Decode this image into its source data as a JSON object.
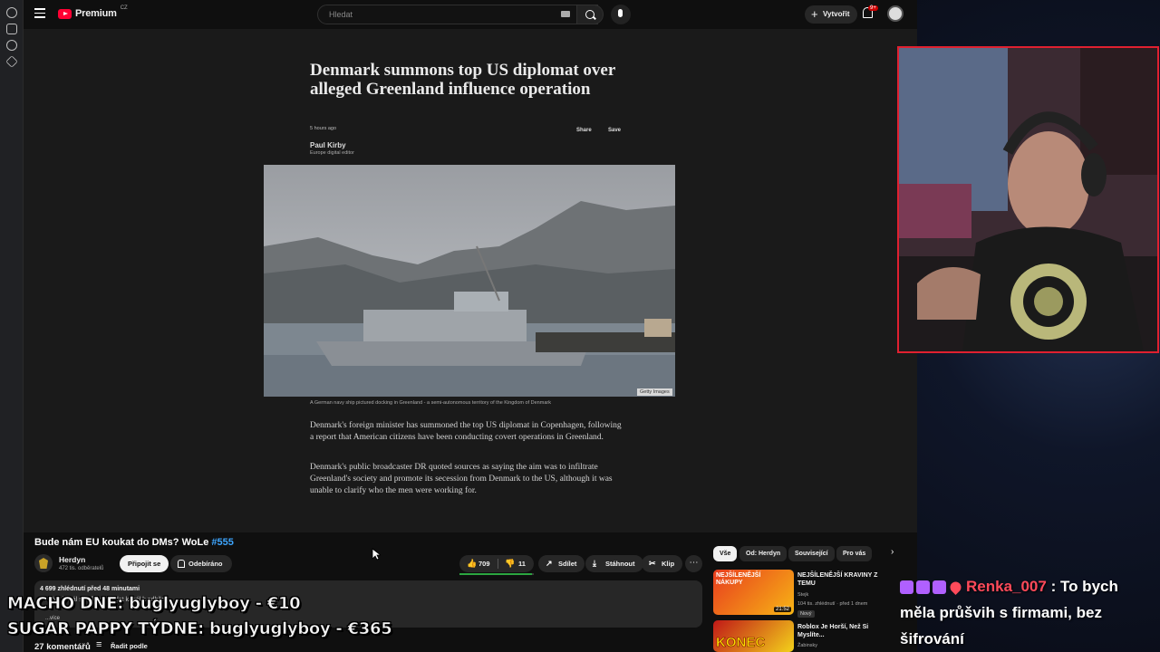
{
  "header": {
    "logo_text": "Premium",
    "logo_country": "CZ",
    "search_placeholder": "Hledat",
    "create_label": "Vytvořit",
    "notification_badge": "9+"
  },
  "article": {
    "headline": "Denmark summons top US diplomat over alleged Greenland influence operation",
    "time": "5 hours ago",
    "share_label": "Share",
    "save_label": "Save",
    "author": "Paul Kirby",
    "author_role": "Europe digital editor",
    "image_credit": "Getty Images",
    "caption": "A German navy ship pictured docking in Greenland - a semi-autonomous territory of the Kingdom of Denmark",
    "paragraph_1": "Denmark's foreign minister has summoned the top US diplomat in Copenhagen, following a report that American citizens have been conducting covert operations in Greenland.",
    "paragraph_2": "Denmark's public broadcaster DR quoted sources as saying the aim was to infiltrate Greenland's society and promote its secession from Denmark to the US, although it was unable to clarify who the men were working for."
  },
  "video": {
    "title": "Bude nám EU koukat do DMs? WoLe ",
    "title_tag": "#555",
    "channel_name": "Herdyn",
    "channel_subs": "472 tis. odběratelů",
    "join_label": "Připojit se",
    "subscribed_label": "Odebíráno",
    "likes": "709",
    "dislikes": "11",
    "like_ratio": 0.98,
    "share_label": "Sdílet",
    "download_label": "Stáhnout",
    "clip_label": "Klip",
    "desc_meta": "4 699 zhlédnutí  před 48 minutami",
    "desc_line": "Herdyn kanál si můžete přidat kanál k odběru:",
    "desc_more": "...více",
    "comments_label": "27 komentářů",
    "sort_label": "Řadit podle"
  },
  "chips": [
    "Vše",
    "Od: Herdyn",
    "Související",
    "Pro vás"
  ],
  "recommendations": [
    {
      "title": "NEJŠÍLENĚJŠÍ KRAVINY Z TEMU",
      "channel": "Stejk",
      "meta": "104 tis. zhlédnutí · před 1 dnem",
      "badge": "Nový",
      "duration": "21:52",
      "thumb_text": "NEJŠÍLENĚJŠÍ NÁKUPY"
    },
    {
      "title": "Roblox Je Horší, Než Si Myslíte...",
      "channel": "Žabinsky",
      "meta": "",
      "badge": "",
      "duration": "",
      "thumb_text": "KONEC"
    }
  ],
  "overlay": {
    "line_1": "MACHO DNE: buglyuglyboy - €10",
    "line_2": "SUGAR PAPPY TÝDNE: buglyuglyboy - €365"
  },
  "chat": {
    "username": "Renka_007",
    "message": " : To bych měla průšvih s firmami, bez šifrování"
  },
  "colors": {
    "accent_red": "#ff0033",
    "link_blue": "#3ea6ff",
    "like_green": "#2ba640",
    "cam_border": "#e02030",
    "chat_name": "#ff4a5a"
  }
}
